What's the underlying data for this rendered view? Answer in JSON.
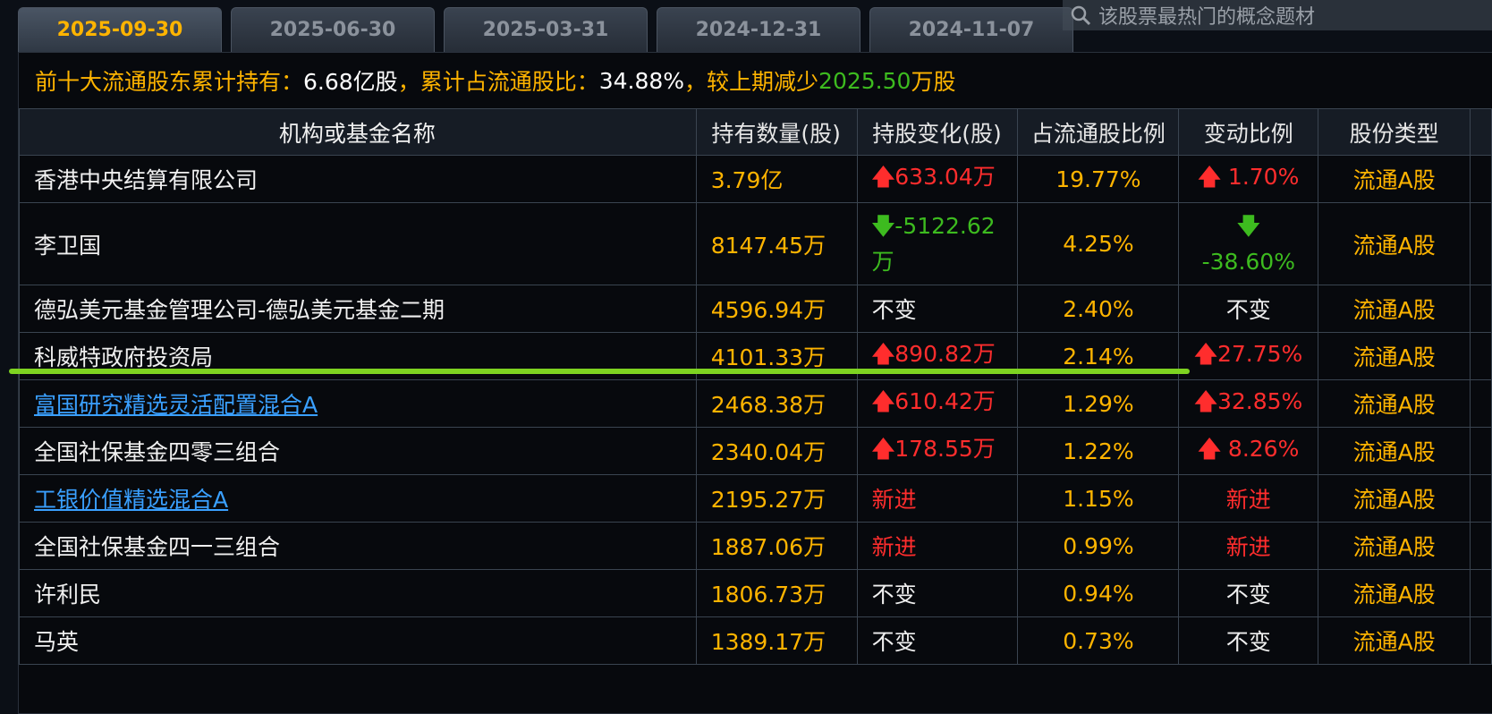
{
  "tabs": [
    "2025-09-30",
    "2025-06-30",
    "2025-03-31",
    "2024-12-31",
    "2024-11-07"
  ],
  "search": {
    "placeholder": "该股票最热门的概念题材",
    "icon": "search-icon"
  },
  "summary": {
    "label1": "前十大流通股东累计持有：",
    "value1": "6.68亿股",
    "label2": "，累计占流通股比：",
    "value2": "34.88%",
    "label3": " ，较上期减少",
    "value3": "2025.50",
    "label4": "万股"
  },
  "table": {
    "headers": [
      "机构或基金名称",
      "持有数量(股)",
      "持股变化(股)",
      "占流通股比例",
      "变动比例",
      "股份类型"
    ],
    "rows": [
      {
        "name": "香港中央结算有限公司",
        "link": false,
        "qty": "3.79亿",
        "chg": "633.04万",
        "chg_dir": "up",
        "pct": "19.77%",
        "ratio": " 1.70%",
        "ratio_dir": "up",
        "type": "流通A股"
      },
      {
        "name": "李卫国",
        "link": false,
        "qty": "8147.45万",
        "chg": "-5122.62万",
        "chg_dir": "down",
        "pct": "4.25%",
        "ratio": " -38.60%",
        "ratio_dir": "down",
        "type": "流通A股"
      },
      {
        "name": "德弘美元基金管理公司-德弘美元基金二期",
        "link": false,
        "qty": "4596.94万",
        "chg": "不变",
        "chg_dir": "same",
        "pct": "2.40%",
        "ratio": "不变",
        "ratio_dir": "same",
        "type": "流通A股"
      },
      {
        "name": "科威特政府投资局",
        "link": false,
        "qty": "4101.33万",
        "chg": "890.82万",
        "chg_dir": "up",
        "pct": "2.14%",
        "ratio": "27.75%",
        "ratio_dir": "up",
        "type": "流通A股"
      },
      {
        "name": "富国研究精选灵活配置混合A",
        "link": true,
        "qty": "2468.38万",
        "chg": "610.42万",
        "chg_dir": "up",
        "pct": "1.29%",
        "ratio": "32.85%",
        "ratio_dir": "up",
        "type": "流通A股"
      },
      {
        "name": "全国社保基金四零三组合",
        "link": false,
        "qty": "2340.04万",
        "chg": "178.55万",
        "chg_dir": "up",
        "pct": "1.22%",
        "ratio": " 8.26%",
        "ratio_dir": "up",
        "type": "流通A股"
      },
      {
        "name": "工银价值精选混合A",
        "link": true,
        "qty": "2195.27万",
        "chg": "新进",
        "chg_dir": "new",
        "pct": "1.15%",
        "ratio": "新进",
        "ratio_dir": "new",
        "type": "流通A股"
      },
      {
        "name": "全国社保基金四一三组合",
        "link": false,
        "qty": "1887.06万",
        "chg": "新进",
        "chg_dir": "new",
        "pct": "0.99%",
        "ratio": "新进",
        "ratio_dir": "new",
        "type": "流通A股"
      },
      {
        "name": "许利民",
        "link": false,
        "qty": "1806.73万",
        "chg": "不变",
        "chg_dir": "same",
        "pct": "0.94%",
        "ratio": "不变",
        "ratio_dir": "same",
        "type": "流通A股"
      },
      {
        "name": "马英",
        "link": false,
        "qty": "1389.17万",
        "chg": "不变",
        "chg_dir": "same",
        "pct": "0.73%",
        "ratio": "不变",
        "ratio_dir": "same",
        "type": "流通A股"
      }
    ]
  },
  "colors": {
    "accent": "#ffb400",
    "up": "#ff2d2d",
    "down": "#3dbb1f",
    "link": "#3aa0ff",
    "annotation_line": "#7ed321"
  }
}
